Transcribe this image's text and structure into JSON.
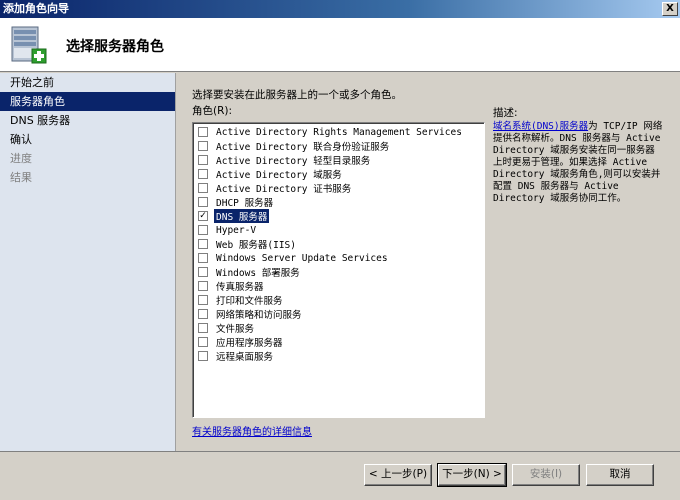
{
  "window": {
    "title": "添加角色向导",
    "close_label": "X"
  },
  "header": {
    "title": "选择服务器角色",
    "icon": "server-add-icon"
  },
  "sidebar": {
    "items": [
      {
        "label": "开始之前",
        "state": "normal"
      },
      {
        "label": "服务器角色",
        "state": "active"
      },
      {
        "label": "DNS 服务器",
        "state": "normal"
      },
      {
        "label": "确认",
        "state": "normal"
      },
      {
        "label": "进度",
        "state": "disabled"
      },
      {
        "label": "结果",
        "state": "disabled"
      }
    ]
  },
  "main": {
    "instruction": "选择要安装在此服务器上的一个或多个角色。",
    "roles_label": "角色(R):",
    "roles": [
      {
        "label": "Active Directory Rights Management Services",
        "checked": false
      },
      {
        "label": "Active Directory 联合身份验证服务",
        "checked": false
      },
      {
        "label": "Active Directory 轻型目录服务",
        "checked": false
      },
      {
        "label": "Active Directory 域服务",
        "checked": false
      },
      {
        "label": "Active Directory 证书服务",
        "checked": false
      },
      {
        "label": "DHCP 服务器",
        "checked": false
      },
      {
        "label": "DNS 服务器",
        "checked": true
      },
      {
        "label": "Hyper-V",
        "checked": false
      },
      {
        "label": "Web 服务器(IIS)",
        "checked": false
      },
      {
        "label": "Windows Server Update Services",
        "checked": false
      },
      {
        "label": "Windows 部署服务",
        "checked": false
      },
      {
        "label": "传真服务器",
        "checked": false
      },
      {
        "label": "打印和文件服务",
        "checked": false
      },
      {
        "label": "网络策略和访问服务",
        "checked": false
      },
      {
        "label": "文件服务",
        "checked": false
      },
      {
        "label": "应用程序服务器",
        "checked": false
      },
      {
        "label": "远程桌面服务",
        "checked": false
      }
    ],
    "description": {
      "title": "描述:",
      "link": "域名系统(DNS)服务器",
      "text": "为 TCP/IP 网络提供名称解析。DNS 服务器与 Active Directory 域服务安装在同一服务器上时更易于管理。如果选择 Active Directory 域服务角色,则可以安装并配置 DNS 服务器与 Active Directory 域服务协同工作。"
    },
    "more_info_link": "有关服务器角色的详细信息"
  },
  "footer": {
    "back": "< 上一步(P)",
    "next": "下一步(N) >",
    "install": "安装(I)",
    "cancel": "取消"
  }
}
